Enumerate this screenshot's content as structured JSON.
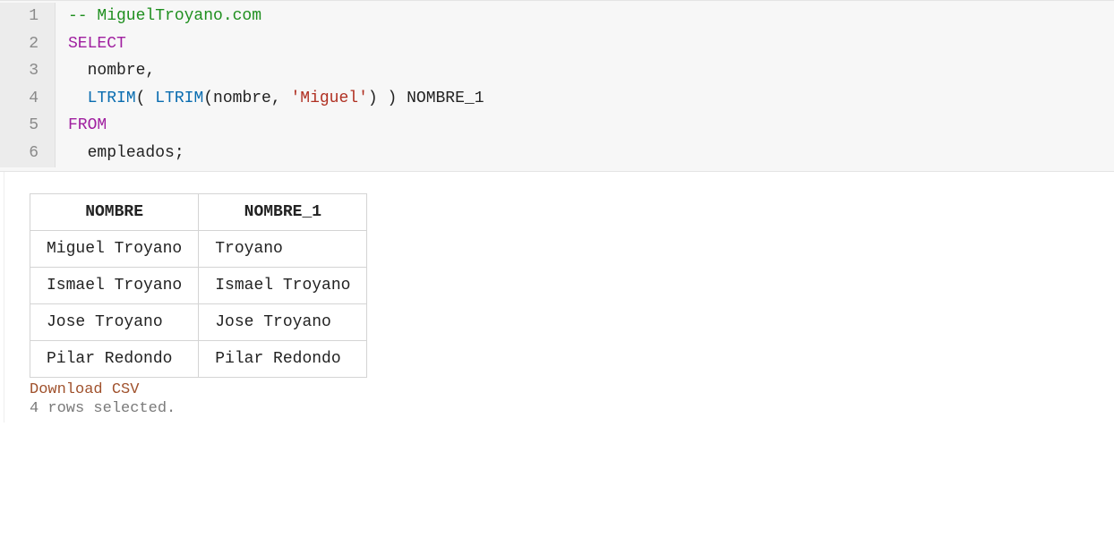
{
  "editor": {
    "lines": [
      {
        "n": "1",
        "tokens": [
          {
            "t": "-- MiguelTroyano.com",
            "c": "tok-comment"
          }
        ]
      },
      {
        "n": "2",
        "tokens": [
          {
            "t": "SELECT",
            "c": "tok-keyword"
          }
        ]
      },
      {
        "n": "3",
        "tokens": [
          {
            "t": "  ",
            "c": "tok-ident"
          },
          {
            "t": "nombre,",
            "c": "tok-ident"
          }
        ]
      },
      {
        "n": "4",
        "tokens": [
          {
            "t": "  ",
            "c": "tok-ident"
          },
          {
            "t": "LTRIM",
            "c": "tok-func"
          },
          {
            "t": "( ",
            "c": "tok-punct"
          },
          {
            "t": "LTRIM",
            "c": "tok-func"
          },
          {
            "t": "(nombre, ",
            "c": "tok-punct"
          },
          {
            "t": "'Miguel'",
            "c": "tok-string"
          },
          {
            "t": ") ) NOMBRE_1",
            "c": "tok-punct"
          }
        ]
      },
      {
        "n": "5",
        "tokens": [
          {
            "t": "FROM",
            "c": "tok-keyword"
          }
        ]
      },
      {
        "n": "6",
        "tokens": [
          {
            "t": "  ",
            "c": "tok-ident"
          },
          {
            "t": "empleados;",
            "c": "tok-ident"
          }
        ]
      }
    ]
  },
  "results": {
    "headers": [
      "NOMBRE",
      "NOMBRE_1"
    ],
    "rows": [
      [
        "Miguel Troyano",
        "Troyano"
      ],
      [
        "Ismael Troyano",
        "Ismael Troyano"
      ],
      [
        "Jose Troyano",
        "Jose Troyano"
      ],
      [
        "Pilar Redondo",
        "Pilar Redondo"
      ]
    ],
    "download_label": "Download CSV",
    "status": "4 rows selected."
  }
}
